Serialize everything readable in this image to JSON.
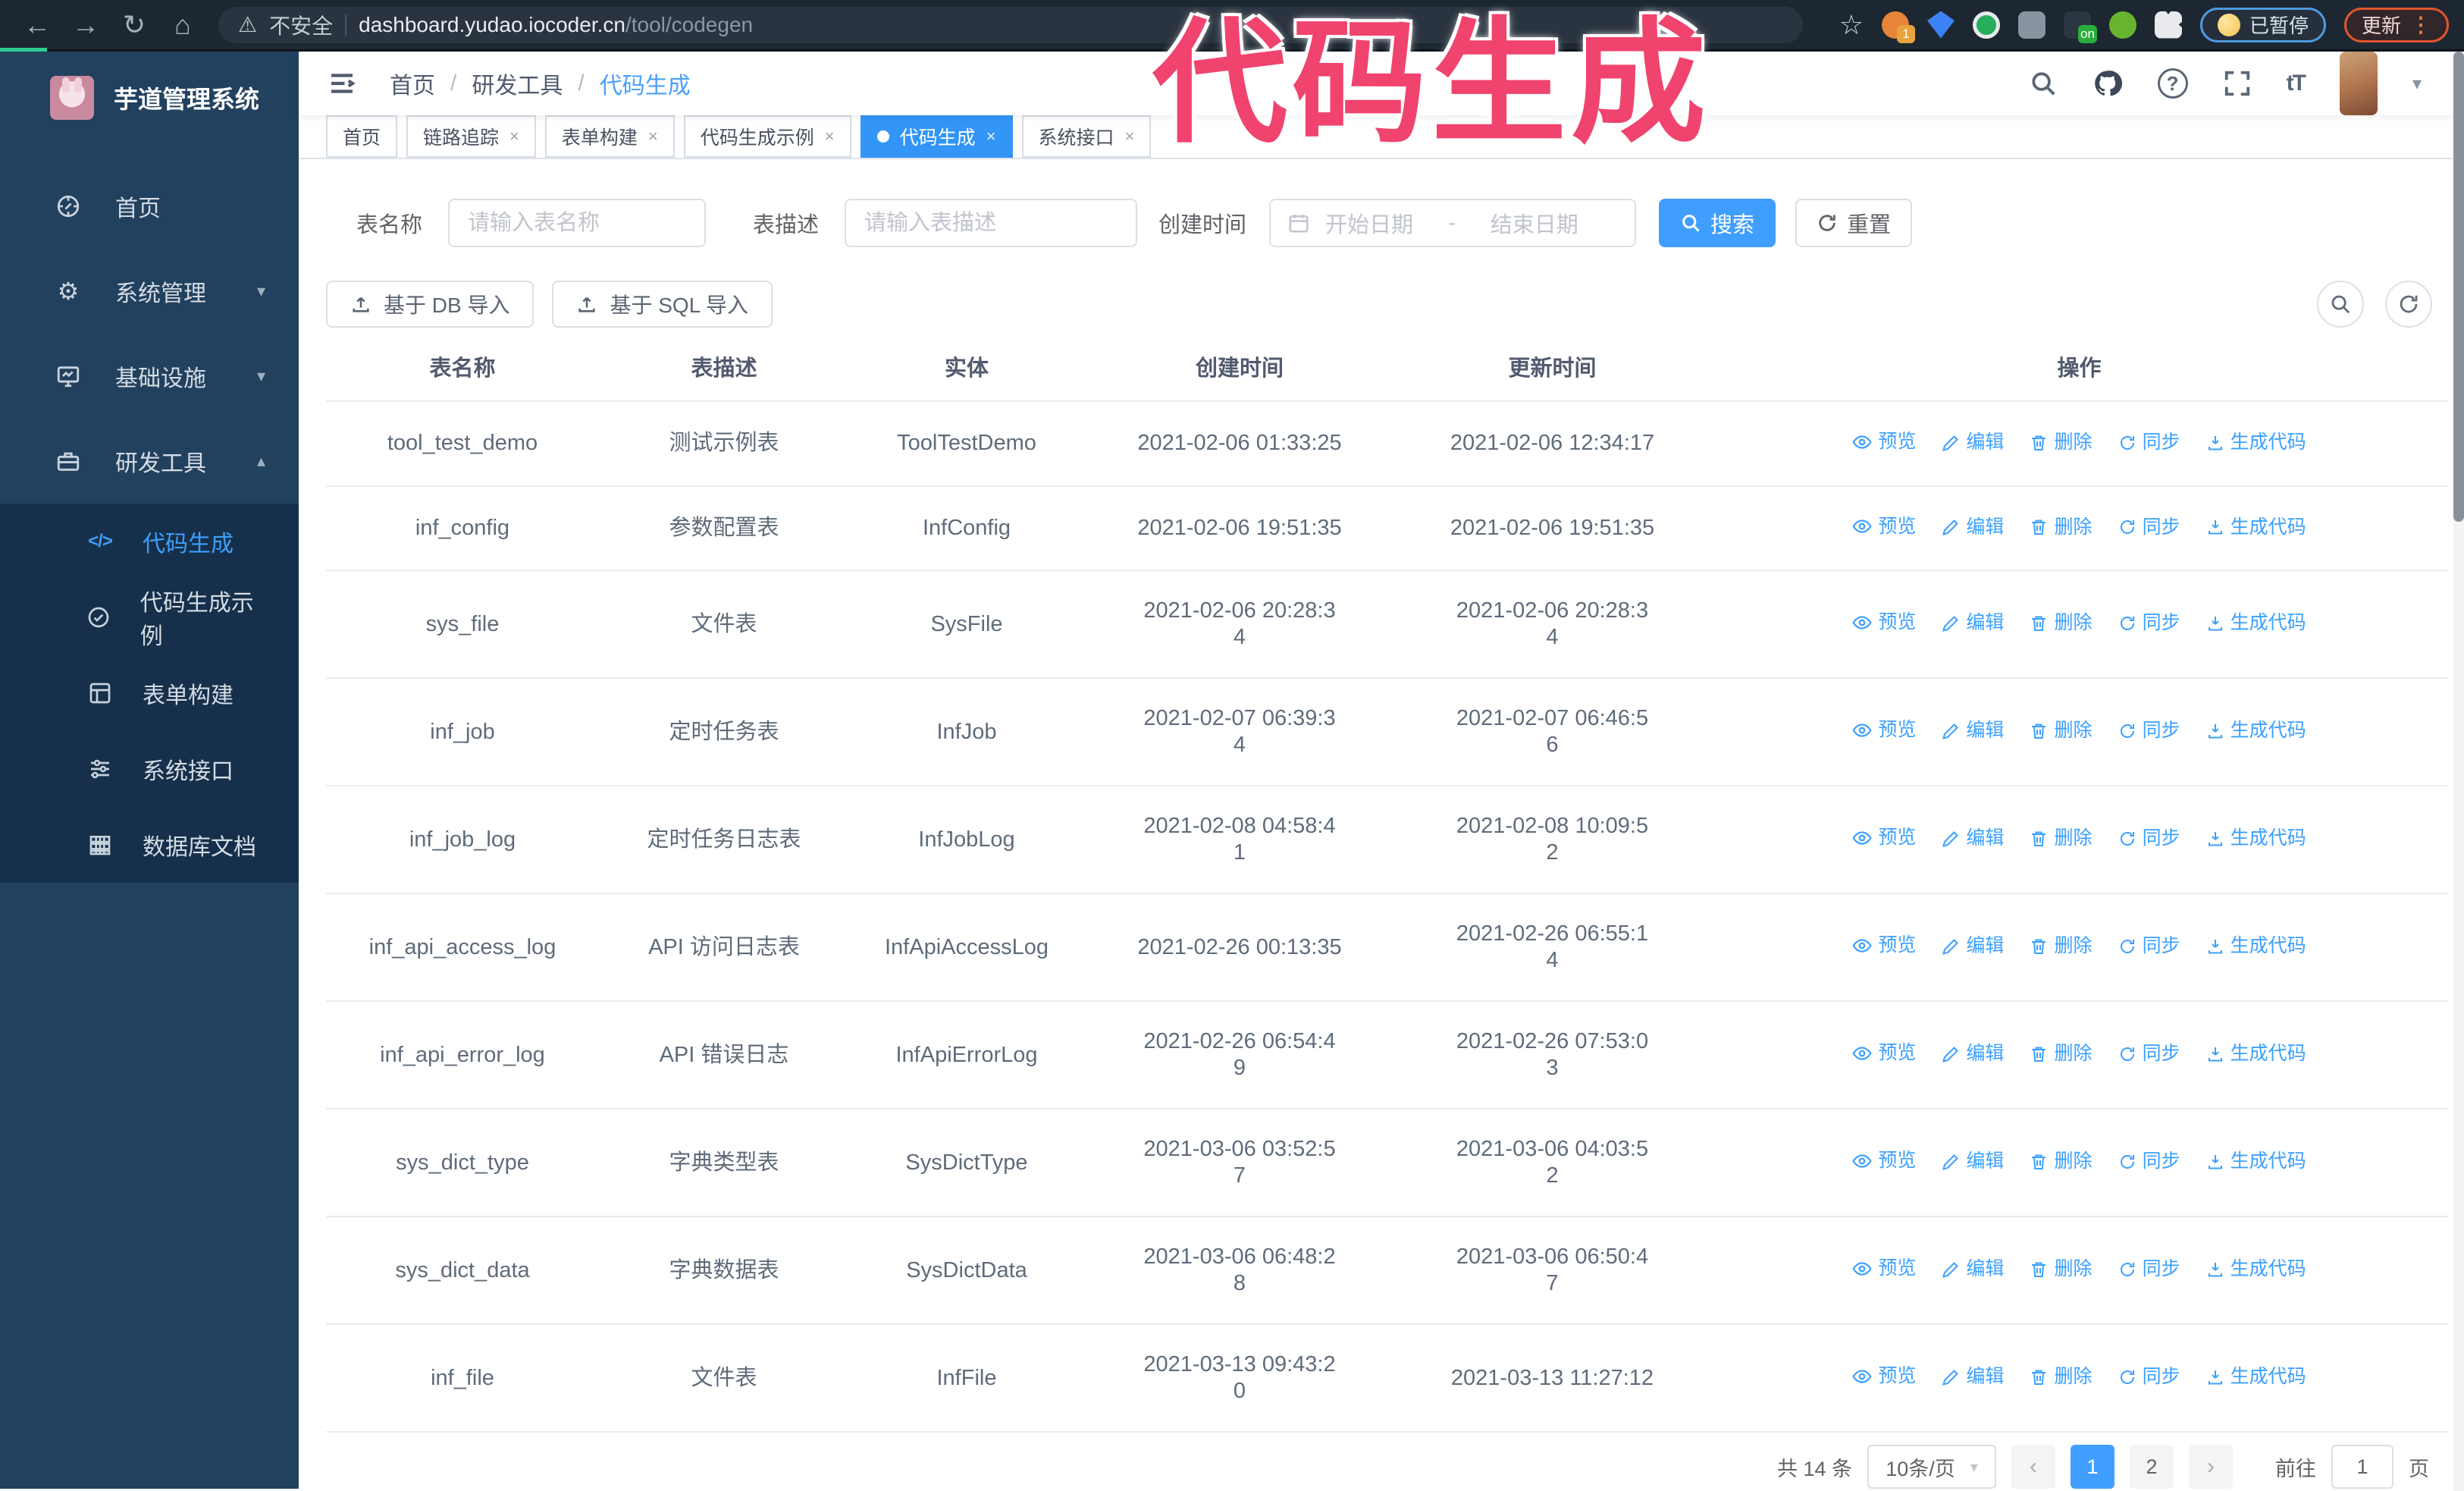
{
  "browser": {
    "security_label": "不安全",
    "url_domain": "dashboard.yudao.iocoder.cn",
    "url_path": "/tool/codegen",
    "paused_label": "已暂停",
    "update_label": "更新",
    "extensions": [
      {
        "color": "#e8833a",
        "badge": "1",
        "badge_color": "#e8a33a"
      },
      {
        "color": "#3b82f6",
        "badge": "",
        "badge_color": ""
      },
      {
        "color": "#27ae5c",
        "badge": "",
        "badge_color": ""
      },
      {
        "color": "#8a93a0",
        "badge": "",
        "badge_color": ""
      },
      {
        "color": "#2b3642",
        "badge": "on",
        "badge_color": "#27ae3b"
      },
      {
        "color": "#67b52f",
        "badge": "",
        "badge_color": ""
      },
      {
        "color": "#e8eaed",
        "badge": "",
        "badge_color": ""
      }
    ]
  },
  "annotation": {
    "text": "代码生成",
    "color": "#f0436e"
  },
  "sidebar": {
    "title": "芋道管理系统",
    "items": [
      {
        "label": "首页"
      },
      {
        "label": "系统管理"
      },
      {
        "label": "基础设施"
      },
      {
        "label": "研发工具"
      }
    ],
    "submenu": [
      {
        "label": "代码生成"
      },
      {
        "label": "代码生成示例"
      },
      {
        "label": "表单构建"
      },
      {
        "label": "系统接口"
      },
      {
        "label": "数据库文档"
      }
    ]
  },
  "header": {
    "breadcrumb": [
      "首页",
      "研发工具",
      "代码生成"
    ]
  },
  "tabs": [
    {
      "label": "首页"
    },
    {
      "label": "链路追踪"
    },
    {
      "label": "表单构建"
    },
    {
      "label": "代码生成示例"
    },
    {
      "label": "代码生成"
    },
    {
      "label": "系统接口"
    }
  ],
  "filters": {
    "name_label": "表名称",
    "name_placeholder": "请输入表名称",
    "desc_label": "表描述",
    "desc_placeholder": "请输入表描述",
    "time_label": "创建时间",
    "start_placeholder": "开始日期",
    "range_separator": "-",
    "end_placeholder": "结束日期",
    "search_label": "搜索",
    "reset_label": "重置"
  },
  "toolbar": {
    "import_db_label": "基于 DB 导入",
    "import_sql_label": "基于 SQL 导入"
  },
  "table": {
    "columns": [
      "表名称",
      "表描述",
      "实体",
      "创建时间",
      "更新时间",
      "操作"
    ],
    "actions": [
      "预览",
      "编辑",
      "删除",
      "同步",
      "生成代码"
    ],
    "rows": [
      {
        "name": "tool_test_demo",
        "desc": "测试示例表",
        "entity": "ToolTestDemo",
        "created": "2021-02-06 01:33:25",
        "updated": "2021-02-06 12:34:17"
      },
      {
        "name": "inf_config",
        "desc": "参数配置表",
        "entity": "InfConfig",
        "created": "2021-02-06 19:51:35",
        "updated": "2021-02-06 19:51:35"
      },
      {
        "name": "sys_file",
        "desc": "文件表",
        "entity": "SysFile",
        "created": "2021-02-06 20:28:3\n4",
        "updated": "2021-02-06 20:28:3\n4"
      },
      {
        "name": "inf_job",
        "desc": "定时任务表",
        "entity": "InfJob",
        "created": "2021-02-07 06:39:3\n4",
        "updated": "2021-02-07 06:46:5\n6"
      },
      {
        "name": "inf_job_log",
        "desc": "定时任务日志表",
        "entity": "InfJobLog",
        "created": "2021-02-08 04:58:4\n1",
        "updated": "2021-02-08 10:09:5\n2"
      },
      {
        "name": "inf_api_access_log",
        "desc": "API 访问日志表",
        "entity": "InfApiAccessLog",
        "created": "2021-02-26 00:13:35",
        "updated": "2021-02-26 06:55:1\n4"
      },
      {
        "name": "inf_api_error_log",
        "desc": "API 错误日志",
        "entity": "InfApiErrorLog",
        "created": "2021-02-26 06:54:4\n9",
        "updated": "2021-02-26 07:53:0\n3"
      },
      {
        "name": "sys_dict_type",
        "desc": "字典类型表",
        "entity": "SysDictType",
        "created": "2021-03-06 03:52:5\n7",
        "updated": "2021-03-06 04:03:5\n2"
      },
      {
        "name": "sys_dict_data",
        "desc": "字典数据表",
        "entity": "SysDictData",
        "created": "2021-03-06 06:48:2\n8",
        "updated": "2021-03-06 06:50:4\n7"
      },
      {
        "name": "inf_file",
        "desc": "文件表",
        "entity": "InfFile",
        "created": "2021-03-13 09:43:2\n0",
        "updated": "2021-03-13 11:27:12"
      }
    ]
  },
  "pagination": {
    "total_label": "共 14 条",
    "page_size_label": "10条/页",
    "pages": [
      "1",
      "2"
    ],
    "active_page": "1",
    "goto_label": "前往",
    "goto_value": "1",
    "page_suffix": "页"
  },
  "colors": {
    "accent": "#409eff",
    "tab_active": "#3295f7",
    "link": "#3aa0ff",
    "sidebar_bg": "#22415e",
    "submenu_bg": "#16304b",
    "sidebar_active": "#3f9efc",
    "chrome_bg": "#1d2731",
    "annotation": "#f0436e",
    "update_border": "#e2552e",
    "paused_border": "#4e9ae0"
  }
}
